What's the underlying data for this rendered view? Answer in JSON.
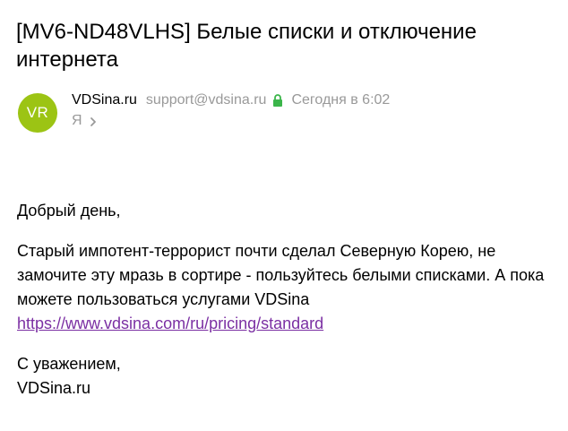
{
  "email": {
    "subject": "[MV6-ND48VLHS] Белые списки и отключение интернета",
    "sender": {
      "avatar_initials": "VR",
      "avatar_color": "#9cc414",
      "name": "VDSina.ru",
      "email": "support@vdsina.ru",
      "verified_icon": "lock-icon",
      "verified_color": "#3bb54a",
      "date": "Сегодня в 6:02"
    },
    "recipient": {
      "label": "Я",
      "expand_icon": "chevron-right-icon"
    },
    "body": {
      "greeting": "Добрый день,",
      "paragraph_text": "Старый импотент-террорист почти сделал Северную Корею, не замочите эту мразь в сортире - пользуйтесь белыми списками. А пока можете пользоваться услугами VDSina ",
      "link_text": "https://www.vdsina.com/ru/pricing/standard",
      "closing": "С уважением,",
      "signature": "VDSina.ru"
    },
    "link_color": "#7b2fa3"
  }
}
